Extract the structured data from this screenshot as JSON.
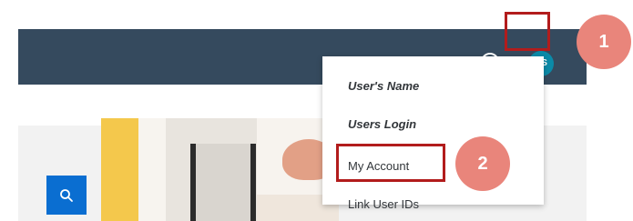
{
  "header": {
    "help_icon": "question-circle",
    "help_glyph": "?",
    "avatar_initials": "BS"
  },
  "search": {
    "icon": "magnifier"
  },
  "user_menu": {
    "items": [
      {
        "label": "User's Name"
      },
      {
        "label": "Users Login"
      },
      {
        "label": "My Account"
      },
      {
        "label": "Link User IDs"
      }
    ]
  },
  "callouts": {
    "step1": "1",
    "step2": "2"
  },
  "colors": {
    "shell_bar": "#354a5e",
    "avatar": "#0b8aa8",
    "search_button": "#0a6ed1",
    "highlight": "#b21c1c",
    "badge": "#e9857b"
  }
}
